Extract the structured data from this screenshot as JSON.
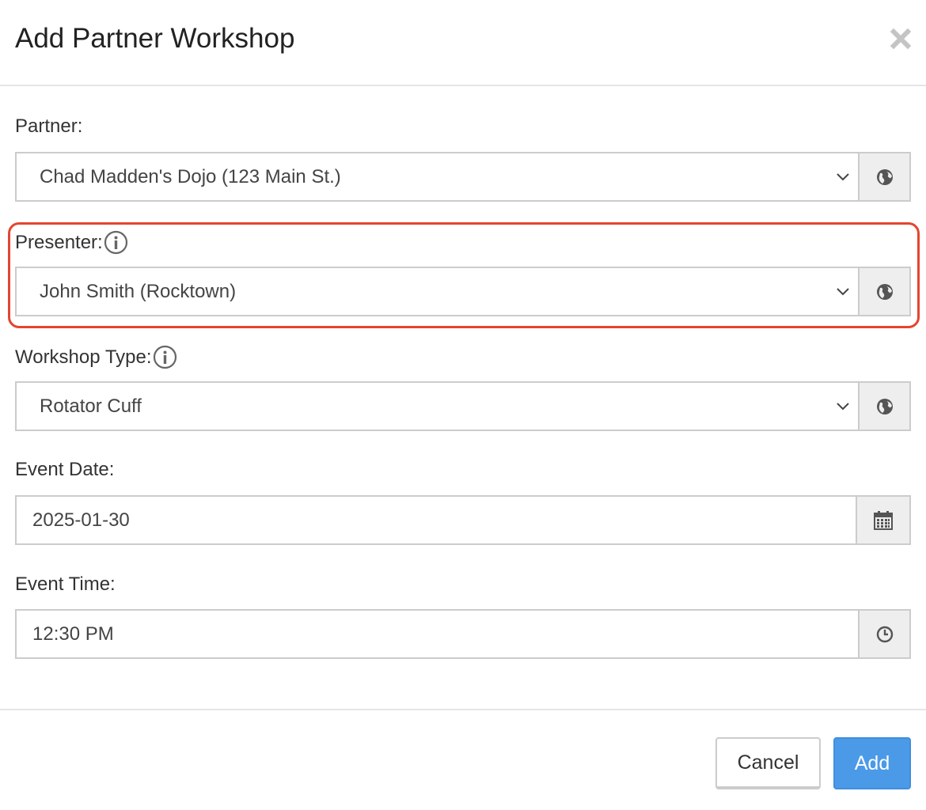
{
  "modal": {
    "title": "Add Partner Workshop",
    "close_icon": "close-icon"
  },
  "fields": {
    "partner": {
      "label": "Partner:",
      "value": "Chad Madden's Dojo (123 Main St.)",
      "addon_icon": "globe-icon"
    },
    "presenter": {
      "label": "Presenter:",
      "value": "John Smith (Rocktown)",
      "info_icon": "info-icon",
      "addon_icon": "globe-icon",
      "highlighted": true,
      "highlight_color": "#e4452f"
    },
    "workshop_type": {
      "label": "Workshop Type:",
      "value": "Rotator Cuff",
      "info_icon": "info-icon",
      "addon_icon": "globe-icon"
    },
    "event_date": {
      "label": "Event Date:",
      "value": "2025-01-30",
      "addon_icon": "calendar-icon"
    },
    "event_time": {
      "label": "Event Time:",
      "value": "12:30 PM",
      "addon_icon": "clock-icon"
    }
  },
  "footer": {
    "cancel_label": "Cancel",
    "add_label": "Add"
  },
  "colors": {
    "primary": "#4a9ae8",
    "highlight": "#e4452f",
    "addon_bg": "#eeeeee",
    "border": "#cccccc"
  }
}
